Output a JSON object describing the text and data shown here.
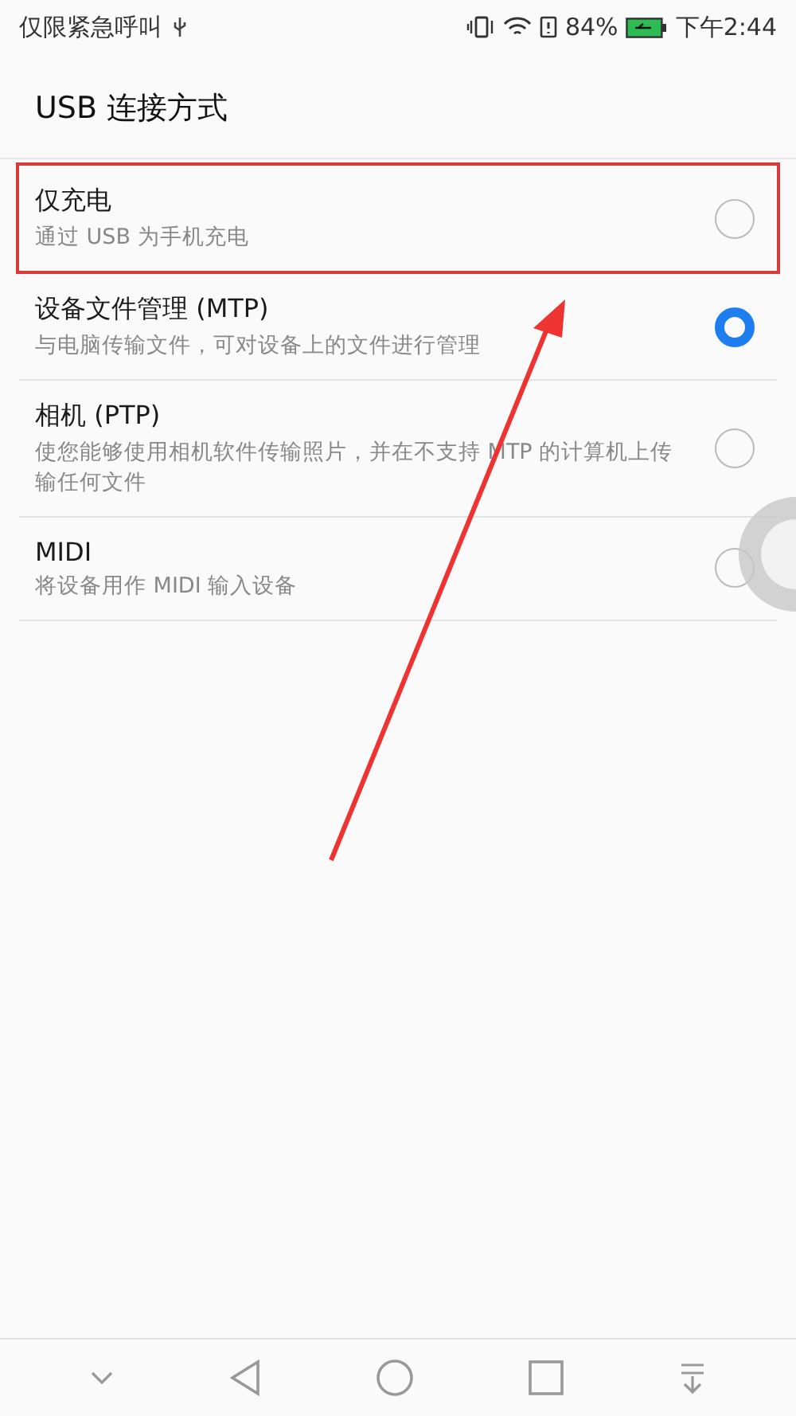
{
  "status_bar": {
    "notice": "仅限紧急呼叫",
    "battery": "84%",
    "time": "下午2:44"
  },
  "title": "USB 连接方式",
  "options": [
    {
      "label": "仅充电",
      "description": "通过 USB 为手机充电",
      "selected": false,
      "highlighted": true
    },
    {
      "label": "设备文件管理 (MTP)",
      "description": "与电脑传输文件，可对设备上的文件进行管理",
      "selected": true,
      "highlighted": false
    },
    {
      "label": "相机 (PTP)",
      "description": "使您能够使用相机软件传输照片，并在不支持 MTP 的计算机上传输任何文件",
      "selected": false,
      "highlighted": false
    },
    {
      "label": "MIDI",
      "description": "将设备用作 MIDI 输入设备",
      "selected": false,
      "highlighted": false
    }
  ]
}
